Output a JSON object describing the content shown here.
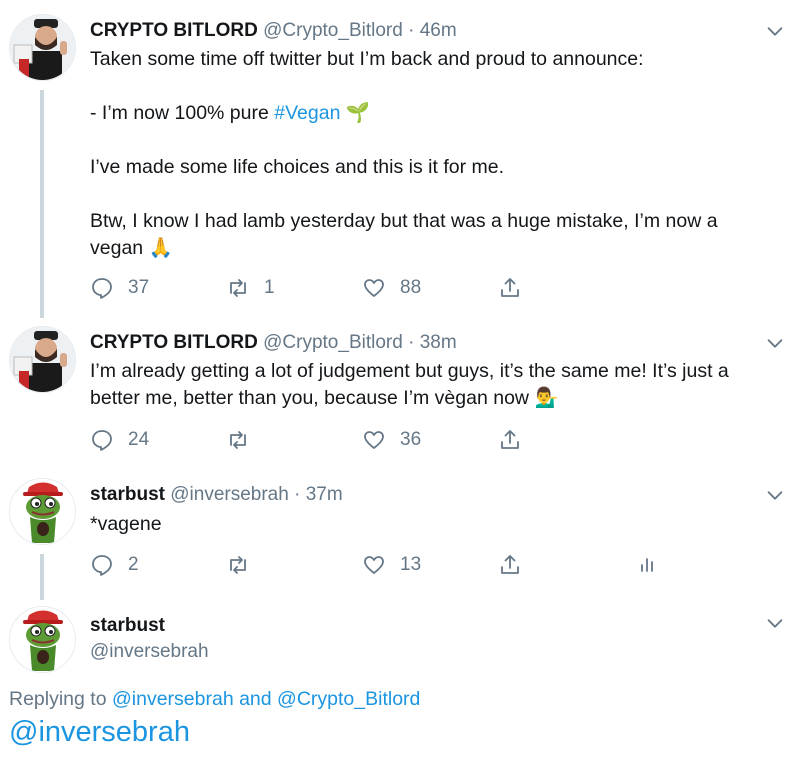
{
  "tweets": [
    {
      "name": "CRYPTO BITLORD",
      "handle": "@Crypto_Bitlord",
      "dot": "·",
      "time": "46m",
      "lines": [
        "Taken some time off twitter but I’m back and proud to announce:",
        "- I’m now 100% pure ",
        "#Vegan",
        "I’ve made some life choices and this is it for me.",
        "Btw, I know I had lamb yesterday but that was a huge mistake, I’m now a",
        "vegan "
      ],
      "emoji_1": "🌱",
      "emoji_2": "🙏",
      "replies": "37",
      "retweets": "1",
      "likes": "88"
    },
    {
      "name": "CRYPTO BITLORD",
      "handle": "@Crypto_Bitlord",
      "dot": "·",
      "time": "38m",
      "lines": [
        "I’m already getting a lot of judgement but guys, it’s the same me! It’s just a",
        "better me, better than you, because I’m vègan now "
      ],
      "emoji": "💁‍♂️",
      "replies": "24",
      "retweets": "",
      "likes": "36"
    },
    {
      "name": "starbust",
      "handle": "@inversebrah",
      "dot": "·",
      "time": "37m",
      "text": "*vagene",
      "replies": "2",
      "retweets": "",
      "likes": "13"
    },
    {
      "name": "starbust",
      "handle": "@inversebrah"
    }
  ],
  "reply": {
    "prefix": "Replying to ",
    "user1": "@inversebrah",
    "and": " and ",
    "user2": "@Crypto_Bitlord",
    "input_value": "@inversebrah"
  },
  "colors": {
    "link": "#1b95e0",
    "muted": "#657786",
    "line": "#ccd6dd"
  }
}
